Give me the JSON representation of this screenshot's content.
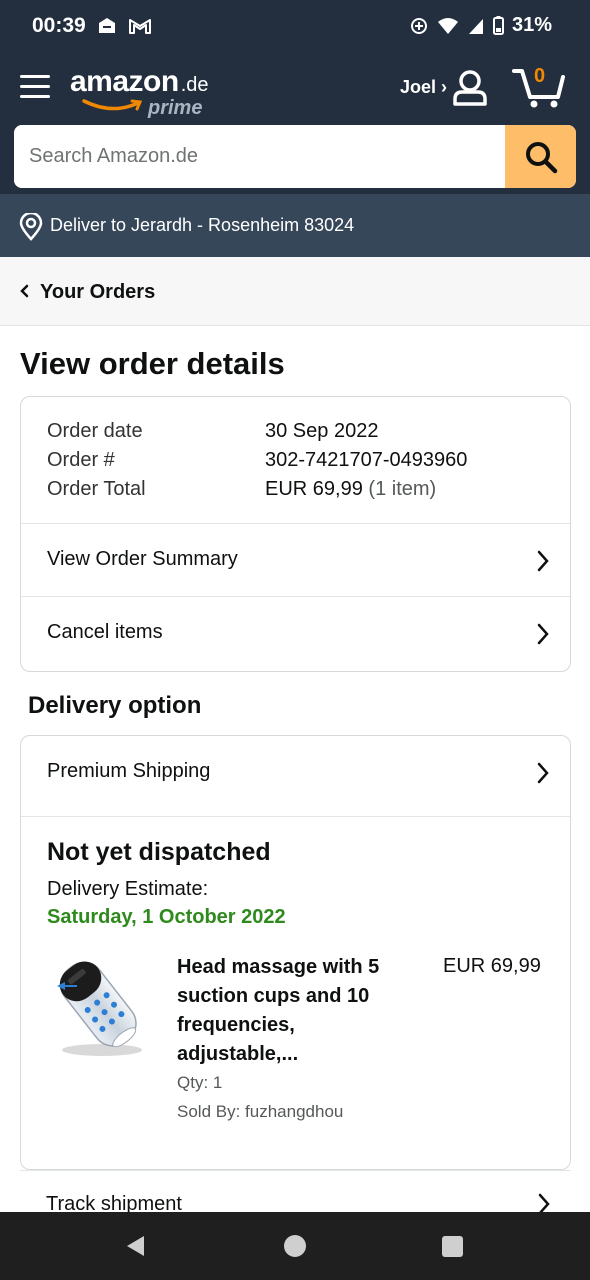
{
  "status_bar": {
    "time": "00:39",
    "battery": "31%"
  },
  "header": {
    "logo_text": "amazon",
    "logo_domain": ".de",
    "logo_sub": "prime",
    "account_label": "Joel ›",
    "cart_count": "0"
  },
  "search": {
    "placeholder": "Search Amazon.de"
  },
  "deliver": {
    "text": "Deliver to Jerardh - Rosenheim 83024"
  },
  "breadcrumb": {
    "label": "Your Orders"
  },
  "page": {
    "title": "View order details"
  },
  "order": {
    "date_label": "Order date",
    "date_value": "30 Sep 2022",
    "number_label": "Order #",
    "number_value": "302-7421707-0493960",
    "total_label": "Order Total",
    "total_value": "EUR 69,99",
    "total_items": "(1 item)",
    "summary_link": "View Order Summary",
    "cancel_link": "Cancel items"
  },
  "delivery": {
    "section_title": "Delivery option",
    "option": "Premium Shipping",
    "status": "Not yet dispatched",
    "estimate_label": "Delivery Estimate:",
    "estimate_date": "Saturday, 1 October 2022",
    "estimate_color": "#2f8a1d",
    "item": {
      "name": "Head massage with 5 suction cups and 10 frequencies, adjustable,...",
      "price": "EUR 69,99",
      "qty": "Qty: 1",
      "sold_by": "Sold By: fuzhangdhou"
    },
    "track_link": "Track shipment"
  },
  "colors": {
    "nav_dark": "#232f3e",
    "deliver_bar": "#37475a",
    "search_button": "#febd69",
    "cart_accent": "#f08804"
  }
}
